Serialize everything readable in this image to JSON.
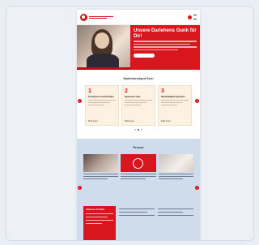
{
  "header": {
    "logo_icon": "brand-logo-icon",
    "icons": [
      "user-icon",
      "menu-icon"
    ]
  },
  "colors": {
    "brand_red": "#d7161d",
    "cream": "#fdf1e1",
    "light_blue": "#cfdcec"
  },
  "hero": {
    "title": "Unsere Darlehens Gunk für Dir!"
  },
  "steps": {
    "title": "Darlehenskauf Sein",
    "cards": [
      {
        "number": "1",
        "title": "Kostenloses Gutschriften",
        "link": "Mehr lesen"
      },
      {
        "number": "2",
        "title": "Sparende Liebe",
        "link": "Mehr lesen"
      },
      {
        "number": "3",
        "title": "Nachhaltigkeit Spenden",
        "link": "Mehr lesen"
      }
    ]
  },
  "press": {
    "title": "Presse",
    "redbox_title": "Aktien aus Produkte"
  }
}
